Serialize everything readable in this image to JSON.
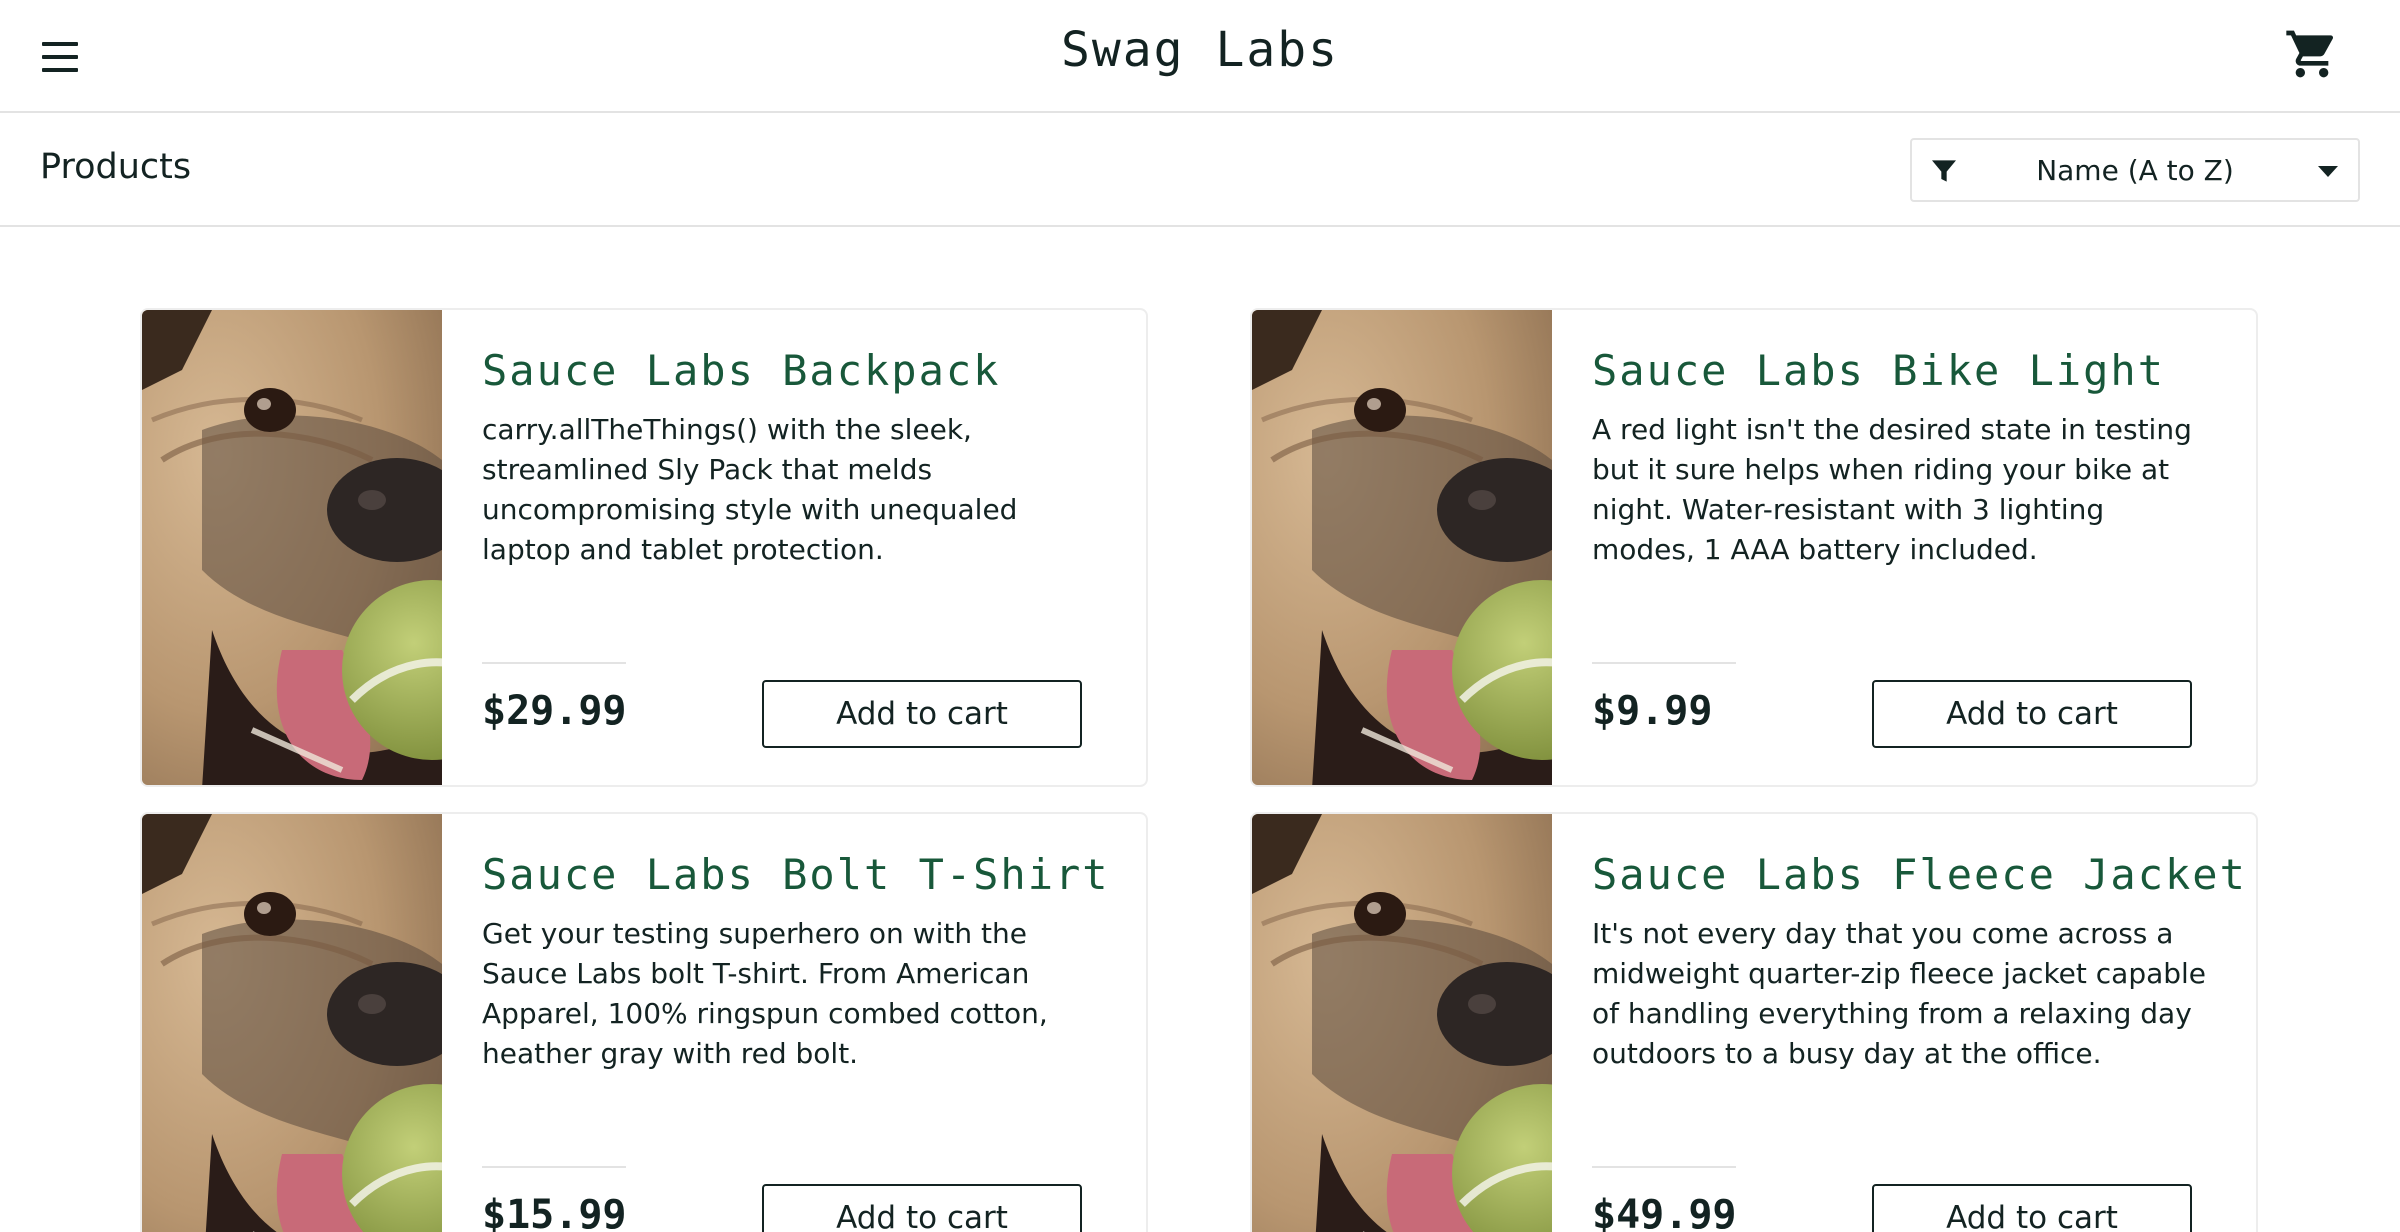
{
  "header": {
    "title": "Swag Labs",
    "menu_icon": "hamburger-menu-icon",
    "cart_icon": "shopping-cart-icon"
  },
  "subheader": {
    "title": "Products",
    "sort": {
      "icon": "filter-icon",
      "selected": "Name (A to Z)"
    }
  },
  "theme": {
    "product_name_color": "#18583a",
    "text_color": "#132322",
    "border_color": "#e3e3e3"
  },
  "products": [
    {
      "name": "Sauce Labs Backpack",
      "description": "carry.allTheThings() with the sleek, streamlined Sly Pack that melds uncompromising style with unequaled laptop and tablet protection.",
      "price": "$29.99",
      "button": "Add to cart"
    },
    {
      "name": "Sauce Labs Bike Light",
      "description": "A red light isn't the desired state in testing but it sure helps when riding your bike at night. Water-resistant with 3 lighting modes, 1 AAA battery included.",
      "price": "$9.99",
      "button": "Add to cart"
    },
    {
      "name": "Sauce Labs Bolt T-Shirt",
      "description": "Get your testing superhero on with the Sauce Labs bolt T-shirt. From American Apparel, 100% ringspun combed cotton, heather gray with red bolt.",
      "price": "$15.99",
      "button": "Add to cart"
    },
    {
      "name": "Sauce Labs Fleece Jacket",
      "description": "It's not every day that you come across a midweight quarter-zip fleece jacket capable of handling everything from a relaxing day outdoors to a busy day at the office.",
      "price": "$49.99",
      "button": "Add to cart"
    }
  ]
}
